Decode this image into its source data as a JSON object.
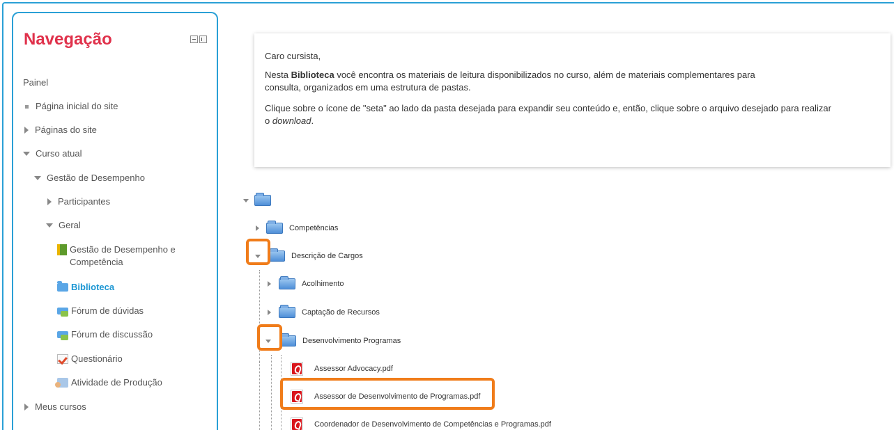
{
  "nav": {
    "title": "Navegação",
    "items": [
      {
        "label": "Painel"
      },
      {
        "label": "Página inicial do site"
      },
      {
        "label": "Páginas do site"
      },
      {
        "label": "Curso atual"
      },
      {
        "label": "Gestão de Desempenho"
      },
      {
        "label": "Participantes"
      },
      {
        "label": "Geral"
      },
      {
        "label": "Gestão de Desempenho e",
        "label2": "Competência"
      },
      {
        "label": "Biblioteca"
      },
      {
        "label": "Fórum de dúvidas"
      },
      {
        "label": "Fórum de discussão"
      },
      {
        "label": "Questionário"
      },
      {
        "label": "Atividade de Produção"
      },
      {
        "label": "Meus cursos"
      }
    ]
  },
  "info": {
    "greeting": "Caro cursista,",
    "p1_before": "Nesta ",
    "p1_bold": "Biblioteca",
    "p1_after": " você encontra os materiais de leitura disponibilizados no curso, além de materiais complementares para",
    "p1_line2": "consulta, organizados em uma estrutura de pastas.",
    "p2_line1": "Clique sobre o ícone de \"seta\" ao lado da pasta desejada para expandir seu conteúdo e, então, clique sobre o arquivo desejado para realizar",
    "p2_prefix": "o ",
    "p2_italic": "download",
    "p2_suffix": "."
  },
  "tree": {
    "folders": [
      {
        "label": "Competências"
      },
      {
        "label": "Descrição de Cargos"
      },
      {
        "label": "Acolhimento"
      },
      {
        "label": "Captação de Recursos"
      },
      {
        "label": "Desenvolvimento Programas"
      }
    ],
    "files": [
      {
        "label": "Assessor Advocacy.pdf"
      },
      {
        "label": "Assessor de Desenvolvimento de Programas.pdf"
      },
      {
        "label": "Coordenador de Desenvolvimento de Competências e Programas.pdf"
      }
    ]
  },
  "colors": {
    "accent": "#2aa0d6",
    "title": "#e0314b",
    "active": "#1b96d3",
    "highlight": "#f07c1a"
  }
}
